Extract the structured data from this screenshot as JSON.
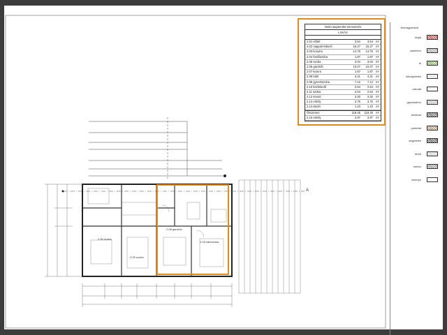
{
  "table": {
    "title": "Nettó alapterület-elrendezés",
    "subtitle": "LAKÁS",
    "rows": [
      {
        "name": "2.01 előtér",
        "a": "3.54",
        "b": "3.54",
        "u": "m²"
      },
      {
        "name": "2.02 nappali-étkező",
        "a": "15.27",
        "b": "15.27",
        "u": "m²"
      },
      {
        "name": "2.03 konyha",
        "a": "14.75",
        "b": "14.75",
        "u": "m²"
      },
      {
        "name": "2.04 fürdőszoba",
        "a": "1.87",
        "b": "1.87",
        "u": "m²"
      },
      {
        "name": "2.05 szoba",
        "a": "3.04",
        "b": "3.04",
        "u": "m²"
      },
      {
        "name": "2.06 gardrób",
        "a": "10.07",
        "b": "10.07",
        "u": "m²"
      },
      {
        "name": "2.07 kamra",
        "a": "1.67",
        "b": "1.67",
        "u": "m²"
      },
      {
        "name": "2.08 háló",
        "a": "4.21",
        "b": "4.21",
        "u": "m²"
      },
      {
        "name": "2.09 gyerekszoba",
        "a": "7.12",
        "b": "7.12",
        "u": "m²"
      },
      {
        "name": "2.10 közlekedő",
        "a": "2.54",
        "b": "2.54",
        "u": "m²"
      },
      {
        "name": "2.11 szoba",
        "a": "2.64",
        "b": "2.64",
        "u": "m²"
      },
      {
        "name": "2.12 terasz",
        "a": "3.30",
        "b": "3.30",
        "u": "m²"
      },
      {
        "name": "2.13 erkély",
        "a": "3.75",
        "b": "3.75",
        "u": "m²"
      },
      {
        "name": "2.14 tároló",
        "a": "1.10",
        "b": "1.10",
        "u": "m²"
      }
    ],
    "sum": {
      "name": "Összesen",
      "a": "118.45",
      "b": "118.45",
      "u": "m²"
    },
    "extra": {
      "name": "2.15 erkély",
      "a": "3.97",
      "b": "3.97",
      "u": "m²"
    }
  },
  "legend": {
    "title": "Jelmagyarázat",
    "items": [
      "tégla",
      "vasbeton",
      "fa",
      "hőszigetelés",
      "vakolat",
      "gipszkarton",
      "kerámia",
      "parketta",
      "szigetelés",
      "térkő",
      "kavics",
      "csempe"
    ]
  },
  "plan": {
    "room_labels": [
      "2.06 szoba",
      "2.05 szoba",
      "2.08 gardrób",
      "1.04 hálószoba"
    ],
    "section_mark": "A"
  }
}
